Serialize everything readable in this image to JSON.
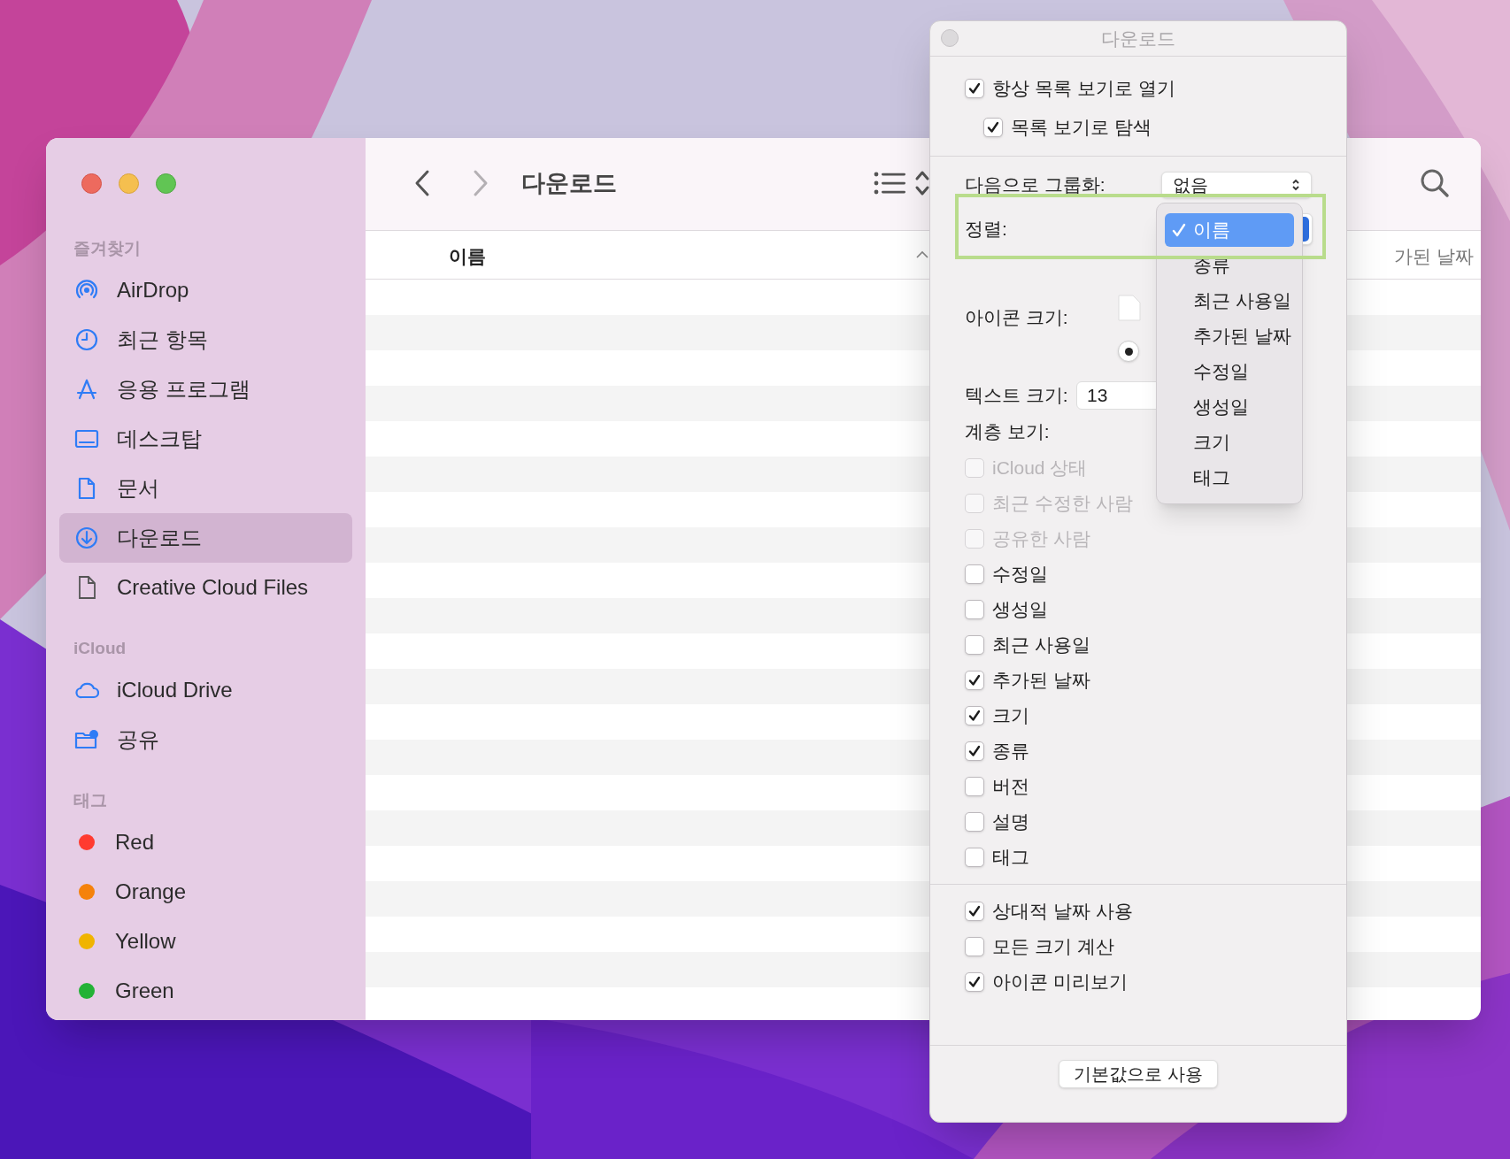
{
  "finder": {
    "sidebar": [
      {
        "title": "즐겨찾기",
        "items": [
          {
            "label": "AirDrop",
            "selected": false
          },
          {
            "label": "최근 항목",
            "selected": false
          },
          {
            "label": "응용 프로그램",
            "selected": false
          },
          {
            "label": "데스크탑",
            "selected": false
          },
          {
            "label": "문서",
            "selected": false
          },
          {
            "label": "다운로드",
            "selected": true
          },
          {
            "label": "Creative Cloud Files",
            "selected": false
          }
        ]
      },
      {
        "title": "iCloud",
        "items": [
          {
            "label": "iCloud Drive",
            "selected": false
          },
          {
            "label": "공유",
            "selected": false
          }
        ]
      },
      {
        "title": "태그",
        "items": [
          {
            "label": "Red",
            "color": "#ff3b30",
            "selected": false
          },
          {
            "label": "Orange",
            "color": "#f5820b",
            "selected": false
          },
          {
            "label": "Yellow",
            "color": "#f0b400",
            "selected": false
          },
          {
            "label": "Green",
            "color": "#23b236",
            "selected": false
          }
        ]
      }
    ],
    "toolbar": {
      "title": "다운로드"
    },
    "columns": [
      {
        "label": "이름"
      },
      {
        "label": "가된 날짜"
      }
    ]
  },
  "view_options": {
    "title": "다운로드",
    "open_options": [
      {
        "label": "항상 목록 보기로 열기",
        "checked": true,
        "children": [
          {
            "label": "목록 보기로 탐색",
            "checked": true
          }
        ]
      }
    ],
    "group_by": {
      "label": "다음으로 그룹화:",
      "value": "없음"
    },
    "sort": {
      "label": "정렬:",
      "menu": [
        {
          "label": "이름",
          "selected": true
        },
        {
          "label": "종류",
          "selected": false
        },
        {
          "label": "최근 사용일",
          "selected": false
        },
        {
          "label": "추가된 날짜",
          "selected": false
        },
        {
          "label": "수정일",
          "selected": false
        },
        {
          "label": "생성일",
          "selected": false
        },
        {
          "label": "크기",
          "selected": false
        },
        {
          "label": "태그",
          "selected": false
        }
      ]
    },
    "icon_size": {
      "label": "아이콘 크기:",
      "selected": true
    },
    "text_size": {
      "label": "텍스트 크기:",
      "value": "13"
    },
    "columns": {
      "label": "계층 보기:",
      "items": [
        {
          "label": "iCloud 상태",
          "checked": false,
          "disabled": true
        },
        {
          "label": "최근 수정한 사람",
          "checked": false,
          "disabled": true
        },
        {
          "label": "공유한 사람",
          "checked": false,
          "disabled": true
        },
        {
          "label": "수정일",
          "checked": false,
          "disabled": false
        },
        {
          "label": "생성일",
          "checked": false,
          "disabled": false
        },
        {
          "label": "최근 사용일",
          "checked": false,
          "disabled": false
        },
        {
          "label": "추가된 날짜",
          "checked": true,
          "disabled": false
        },
        {
          "label": "크기",
          "checked": true,
          "disabled": false
        },
        {
          "label": "종류",
          "checked": true,
          "disabled": false
        },
        {
          "label": "버전",
          "checked": false,
          "disabled": false
        },
        {
          "label": "설명",
          "checked": false,
          "disabled": false
        },
        {
          "label": "태그",
          "checked": false,
          "disabled": false
        }
      ]
    },
    "more_options": [
      {
        "label": "상대적 날짜 사용",
        "checked": true
      },
      {
        "label": "모든 크기 계산",
        "checked": false
      },
      {
        "label": "아이콘 미리보기",
        "checked": true
      }
    ],
    "button": "기본값으로 사용"
  }
}
